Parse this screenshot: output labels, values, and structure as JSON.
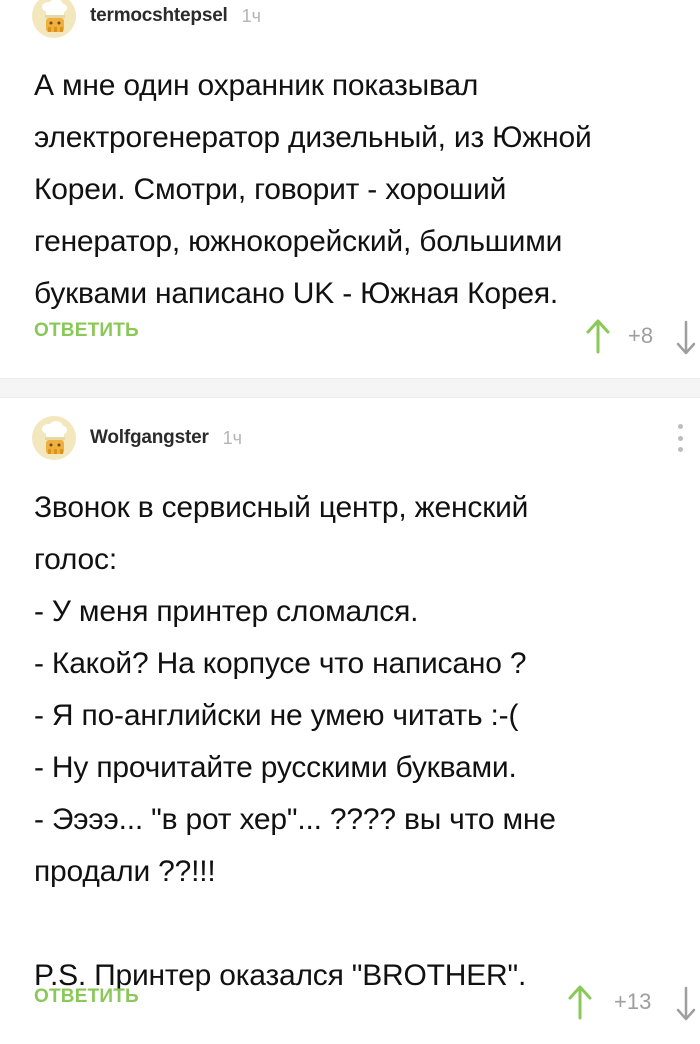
{
  "comments": [
    {
      "username": "termocshtepsel",
      "time": "1ч",
      "lines": [
        "А мне один охранник показывал",
        "электрогенератор дизельный, из Южной",
        "Кореи. Смотри, говорит - хороший",
        "генератор, южнокорейский, большими",
        "буквами написано UK - Южная Корея."
      ],
      "reply_label": "ОТВЕТИТЬ",
      "rating": "+8"
    },
    {
      "username": "Wolfgangster",
      "time": "1ч",
      "lines": [
        "Звонок в сервисный центр, женский",
        "голос:",
        "- У меня принтер сломался.",
        "- Какой? На корпусе что написано ?",
        "- Я по-английски не умею читать :-(",
        "- Ну прочитайте русскими буквами.",
        "- Ээээ... \"в рот хер\"... ???? вы что мне",
        "продали ??!!!",
        "",
        "P.S. Принтер оказался \"BROTHER\"."
      ],
      "reply_label": "ОТВЕТИТЬ",
      "rating": "+13"
    }
  ],
  "icons": {
    "avatar": "chef-avatar-icon",
    "upvote": "arrow-up-icon",
    "downvote": "arrow-down-icon",
    "more": "more-vertical-icon"
  },
  "colors": {
    "reply": "#8ac858",
    "upvote": "#8ac858",
    "downvote": "#9e9e9e",
    "rating": "#9e9e9e",
    "time": "#b5b5b5",
    "text": "#111111"
  }
}
